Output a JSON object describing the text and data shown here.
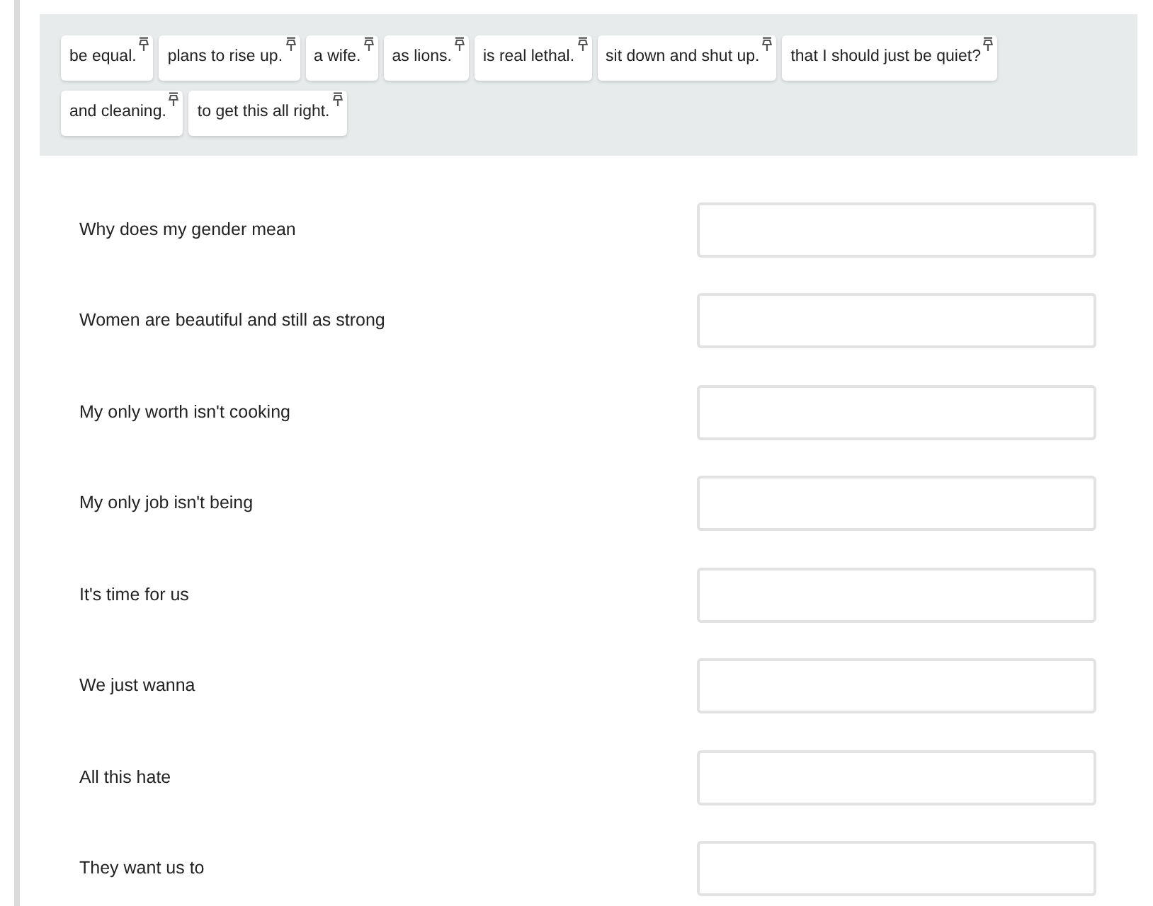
{
  "chips": [
    {
      "text": "be equal."
    },
    {
      "text": "plans to rise up."
    },
    {
      "text": "a wife."
    },
    {
      "text": "as lions."
    },
    {
      "text": "is real lethal."
    },
    {
      "text": "sit down and shut up."
    },
    {
      "text": "that I should just be quiet?"
    },
    {
      "text": "and cleaning."
    },
    {
      "text": "to get this all right."
    }
  ],
  "rows": [
    {
      "prompt": "Why does my gender mean"
    },
    {
      "prompt": "Women are beautiful and still as strong"
    },
    {
      "prompt": "My only worth isn't cooking"
    },
    {
      "prompt": "My only job isn't being"
    },
    {
      "prompt": "It's time for us"
    },
    {
      "prompt": "We just wanna"
    },
    {
      "prompt": "All this hate"
    },
    {
      "prompt": "They want us to"
    }
  ]
}
